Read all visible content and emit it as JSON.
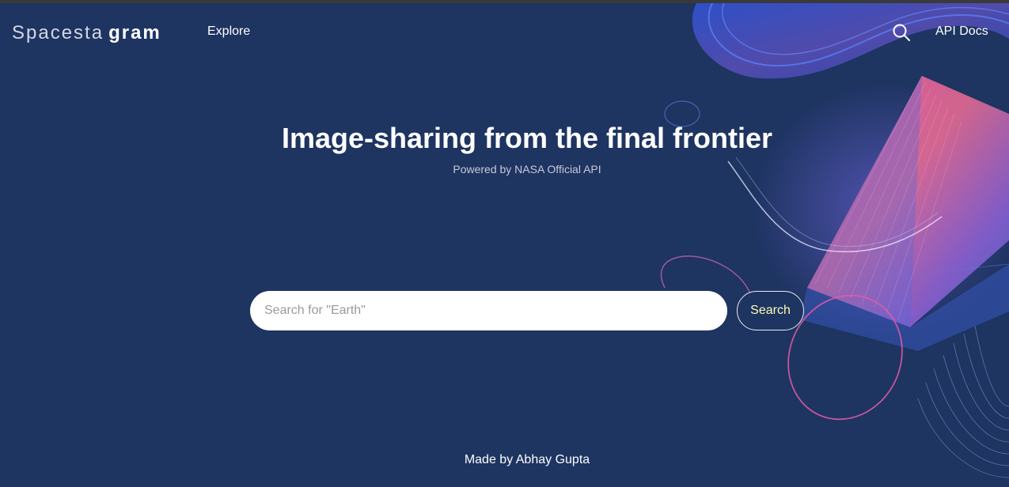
{
  "header": {
    "logo_light": "Spacesta",
    "logo_bold": "gram",
    "nav_explore": "Explore",
    "nav_api_docs": "API Docs",
    "search_icon": "search-icon"
  },
  "hero": {
    "title": "Image-sharing from the final frontier",
    "subtitle": "Powered by NASA Official API"
  },
  "search": {
    "placeholder": "Search for \"Earth\"",
    "value": "",
    "button_label": "Search"
  },
  "footer": {
    "credit": "Made by Abhay Gupta"
  },
  "colors": {
    "background": "#1e3461",
    "button_text": "#fdfbb6",
    "accent_pink": "#ec5fa6",
    "accent_blue": "#3b5bd6"
  }
}
